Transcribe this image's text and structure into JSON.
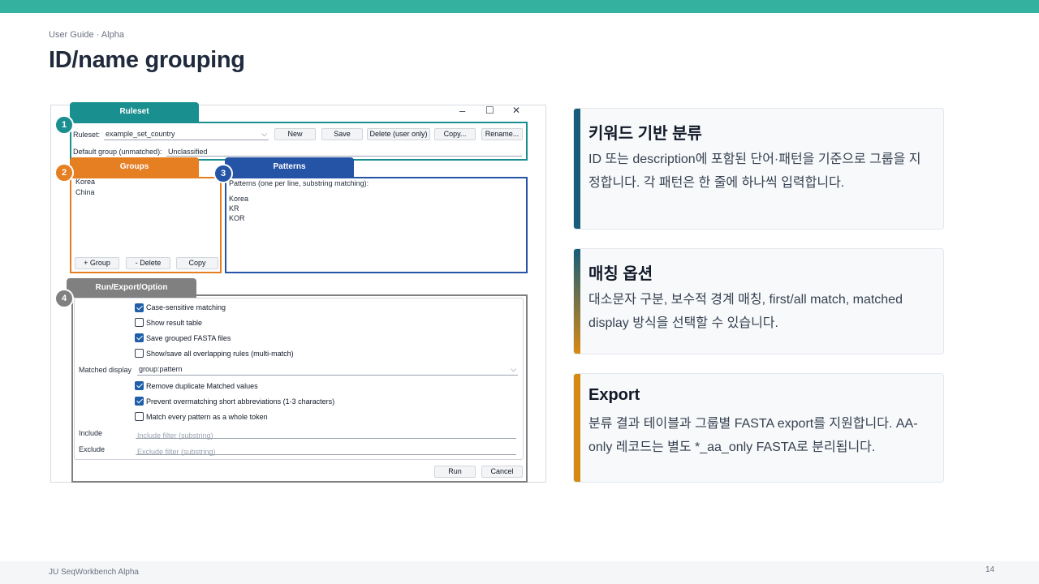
{
  "header": {
    "breadcrumb": "User Guide · Alpha",
    "title": "ID/name grouping"
  },
  "footer": {
    "left": "JU SeqWorkbench Alpha",
    "page_number": "14"
  },
  "screenshot": {
    "window_controls": {
      "minimize": "–",
      "maximize": "☐",
      "close": "✕"
    },
    "sections": {
      "ruleset": {
        "tag": "Ruleset",
        "badge": "1"
      },
      "groups": {
        "tag": "Groups",
        "badge": "2"
      },
      "patterns": {
        "tag": "Patterns",
        "badge": "3"
      },
      "run": {
        "tag": "Run/Export/Option",
        "badge": "4"
      }
    },
    "ruleset": {
      "label": "Ruleset:",
      "selected": "example_set_country",
      "buttons": [
        "New",
        "Save",
        "Delete (user only)",
        "Copy...",
        "Rename..."
      ],
      "default_group_label": "Default group (unmatched):",
      "default_group_value": "Unclassified"
    },
    "groups": {
      "items": [
        "Korea",
        "China"
      ],
      "buttons": [
        "+ Group",
        "- Delete",
        "Copy"
      ]
    },
    "patterns": {
      "header": "Patterns (one per line, substring matching):",
      "lines": [
        "Korea",
        "KR",
        "KOR"
      ]
    },
    "options": {
      "checkboxes_top": [
        {
          "label": "Case-sensitive matching",
          "checked": true
        },
        {
          "label": "Show result table",
          "checked": false
        },
        {
          "label": "Save grouped FASTA files",
          "checked": true
        },
        {
          "label": "Show/save all overlapping rules (multi-match)",
          "checked": false
        }
      ],
      "matched_display_label": "Matched display",
      "matched_display_value": "group:pattern",
      "checkboxes_bottom": [
        {
          "label": "Remove duplicate Matched values",
          "checked": true
        },
        {
          "label": "Prevent overmatching short abbreviations (1-3 characters)",
          "checked": true
        },
        {
          "label": "Match every pattern as a whole token",
          "checked": false
        }
      ],
      "include_label": "Include",
      "include_placeholder": "Include filter (substring)",
      "exclude_label": "Exclude",
      "exclude_placeholder": "Exclude filter (substring)",
      "run_button": "Run",
      "cancel_button": "Cancel"
    }
  },
  "cards": [
    {
      "title": "키워드 기반 분류",
      "body": "ID 또는 description에 포함된 단어·패턴을 기준으로 그룹을 지정합니다. 각 패턴은 한 줄에 하나씩 입력합니다."
    },
    {
      "title": "매칭 옵션",
      "body": "대소문자 구분, 보수적 경계 매칭, first/all match, matched display 방식을 선택할 수 있습니다."
    },
    {
      "title": "Export",
      "body": "분류 결과 테이블과 그룹별 FASTA export를 지원합니다. AA-only 레코드는 별도 *_aa_only FASTA로 분리됩니다."
    }
  ],
  "colors": {
    "ruleset": "#1a8f8f",
    "groups": "#e67e22",
    "patterns": "#2554a6",
    "run": "#808080",
    "card1_stripe": "#175c7a",
    "card3_stripe": "#d68a14"
  }
}
